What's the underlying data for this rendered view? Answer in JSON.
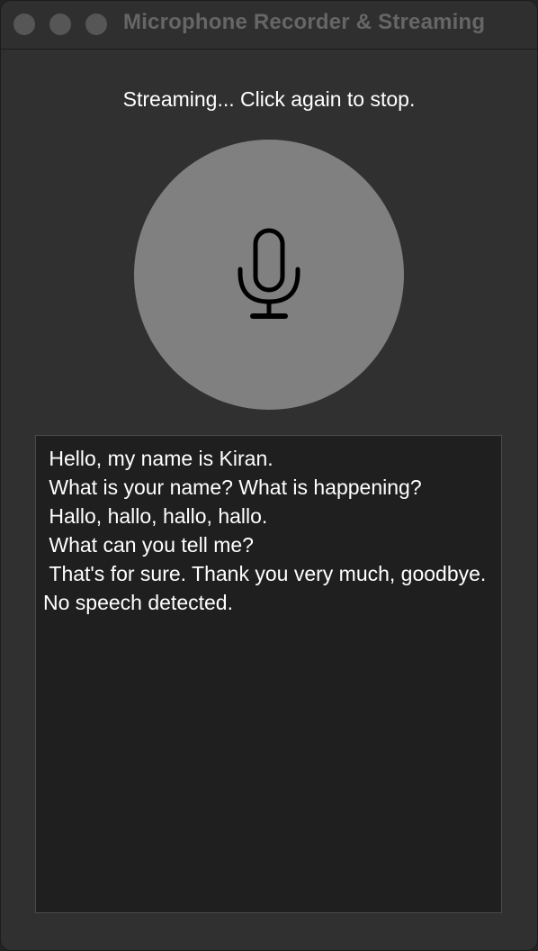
{
  "window": {
    "title": "Microphone Recorder & Streaming"
  },
  "status": {
    "text": "Streaming... Click again to stop."
  },
  "mic_button": {
    "icon": "microphone-icon",
    "color": "#808080"
  },
  "transcript": {
    "lines": [
      " Hello, my name is Kiran.",
      " What is your name? What is happening?",
      " Hallo, hallo, hallo, hallo.",
      " What can you tell me?",
      " That's for sure. Thank you very much, goodbye.",
      "No speech detected."
    ]
  },
  "colors": {
    "window_background": "#303030",
    "transcript_background": "#1f1f1f",
    "text": "#ffffff",
    "title_text": "#666666"
  }
}
